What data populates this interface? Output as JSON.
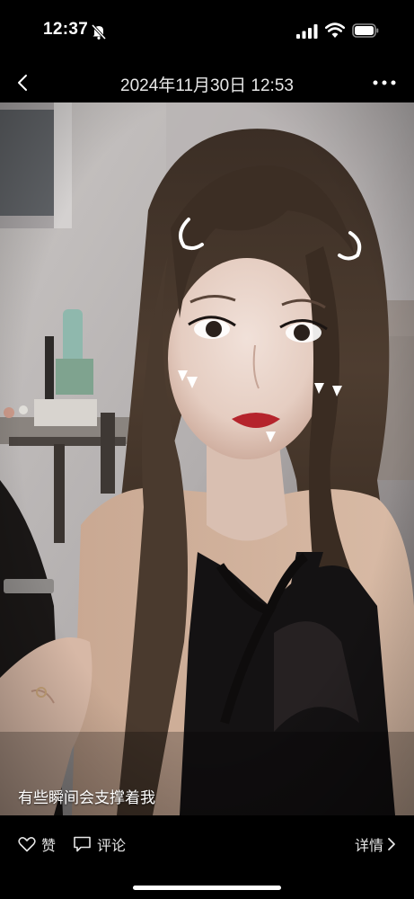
{
  "status_bar": {
    "time": "12:37",
    "icons": [
      "bell-off-icon",
      "cellular-signal-icon",
      "wifi-icon",
      "battery-icon"
    ]
  },
  "nav": {
    "title": "2024年11月30日 12:53",
    "icons": [
      "back-icon",
      "more-icon"
    ]
  },
  "post": {
    "caption": "有些瞬间会支撑着我"
  },
  "actions": {
    "like_label": "赞",
    "comment_label": "评论",
    "details_label": "详情"
  },
  "colors": {
    "background": "#000000",
    "text": "#ffffff"
  }
}
